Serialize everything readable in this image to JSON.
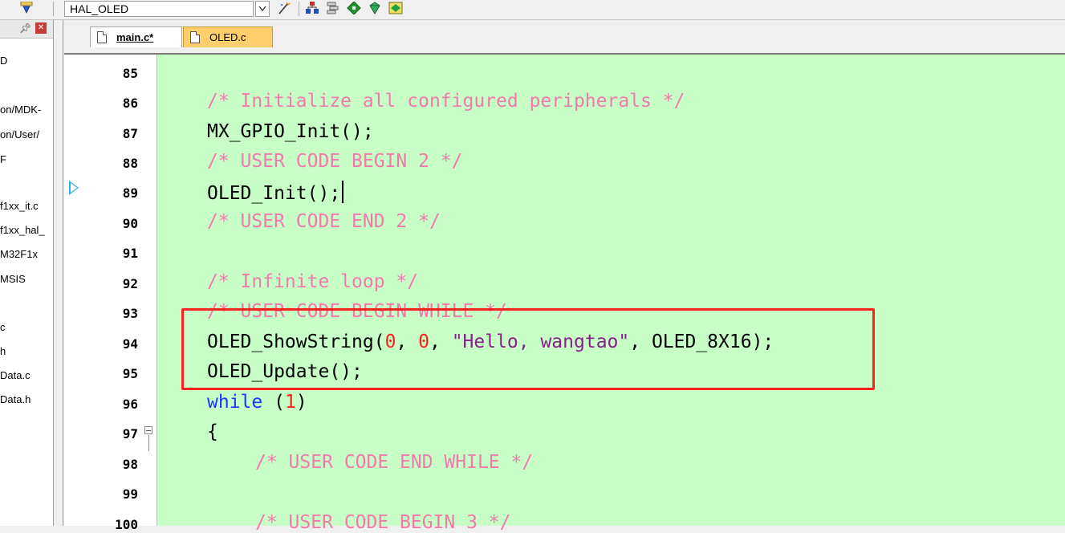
{
  "toolbar": {
    "target_name": "HAL_OLED"
  },
  "project_pane": {
    "items": [
      "D",
      "on/MDK-",
      "on/User/",
      "F",
      "f1xx_it.c",
      "f1xx_hal_",
      "M32F1x",
      "MSIS",
      "c",
      "h",
      "Data.c",
      "Data.h"
    ]
  },
  "tabs": [
    {
      "label": "main.c*",
      "active": true
    },
    {
      "label": "OLED.c",
      "active": false
    }
  ],
  "editor": {
    "line_numbers": [
      "85",
      "86",
      "87",
      "88",
      "89",
      "90",
      "91",
      "92",
      "93",
      "94",
      "95",
      "96",
      "97",
      "98",
      "99",
      "100"
    ],
    "lines": {
      "l86": "/* Initialize all configured peripherals */",
      "l87": "MX_GPIO_Init();",
      "l88": "/* USER CODE BEGIN 2 */",
      "l89": "OLED_Init();",
      "l90": "/* USER CODE END 2 */",
      "l92": "/* Infinite loop */",
      "l93": "/* USER CODE BEGIN WHILE */",
      "l94_fn": "OLED_ShowString(",
      "l94_n1": "0",
      "l94_sep1": ", ",
      "l94_n2": "0",
      "l94_sep2": ", ",
      "l94_str": "\"Hello, wangtao\"",
      "l94_rest": ", OLED_8X16);",
      "l95": "OLED_Update();",
      "l96_kw": "while",
      "l96_open": " (",
      "l96_num": "1",
      "l96_close": ")",
      "l97": "{",
      "l98": "/* USER CODE END WHILE */",
      "l100": "/* USER CODE BEGIN 3 */"
    }
  },
  "colors": {
    "code_background": "#c7ffc7",
    "comment": "#f07aaa",
    "keyword": "#1a35ff",
    "number": "#ff1c1c",
    "string": "#8a1f8a",
    "highlight_box": "#ff2020",
    "active_file_tab": "#ffcf6b"
  }
}
